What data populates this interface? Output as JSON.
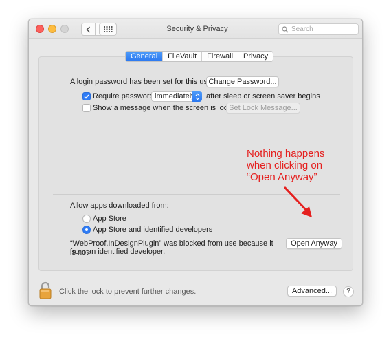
{
  "window": {
    "title": "Security & Privacy",
    "search_placeholder": "Search"
  },
  "tabs": [
    {
      "label": "General",
      "active": true
    },
    {
      "label": "FileVault",
      "active": false
    },
    {
      "label": "Firewall",
      "active": false
    },
    {
      "label": "Privacy",
      "active": false
    }
  ],
  "general": {
    "login_password_text": "A login password has been set for this user",
    "change_password_label": "Change Password...",
    "require_password_label": "Require password",
    "require_password_checked": true,
    "require_password_value": "immediately",
    "require_password_suffix": "after sleep or screen saver begins",
    "show_message_label": "Show a message when the screen is locked",
    "show_message_checked": false,
    "set_lock_message_label": "Set Lock Message..."
  },
  "downloads": {
    "heading": "Allow apps downloaded from:",
    "options": [
      {
        "label": "App Store",
        "selected": false
      },
      {
        "label": "App Store and identified developers",
        "selected": true
      }
    ],
    "blocked_line1": "“WebProof.InDesignPlugin” was blocked from use because it is not",
    "blocked_line2": "from an identified developer.",
    "open_anyway_label": "Open Anyway"
  },
  "footer": {
    "lock_text": "Click the lock to prevent further changes.",
    "advanced_label": "Advanced...",
    "help_label": "?"
  },
  "annotation": {
    "line1": "Nothing happens",
    "line2": "when clicking on",
    "line3": "“Open Anyway”",
    "color": "#e5201f"
  },
  "colors": {
    "accent": "#2f7cf6",
    "close": "#fc605c",
    "minimize": "#fdbc40"
  }
}
